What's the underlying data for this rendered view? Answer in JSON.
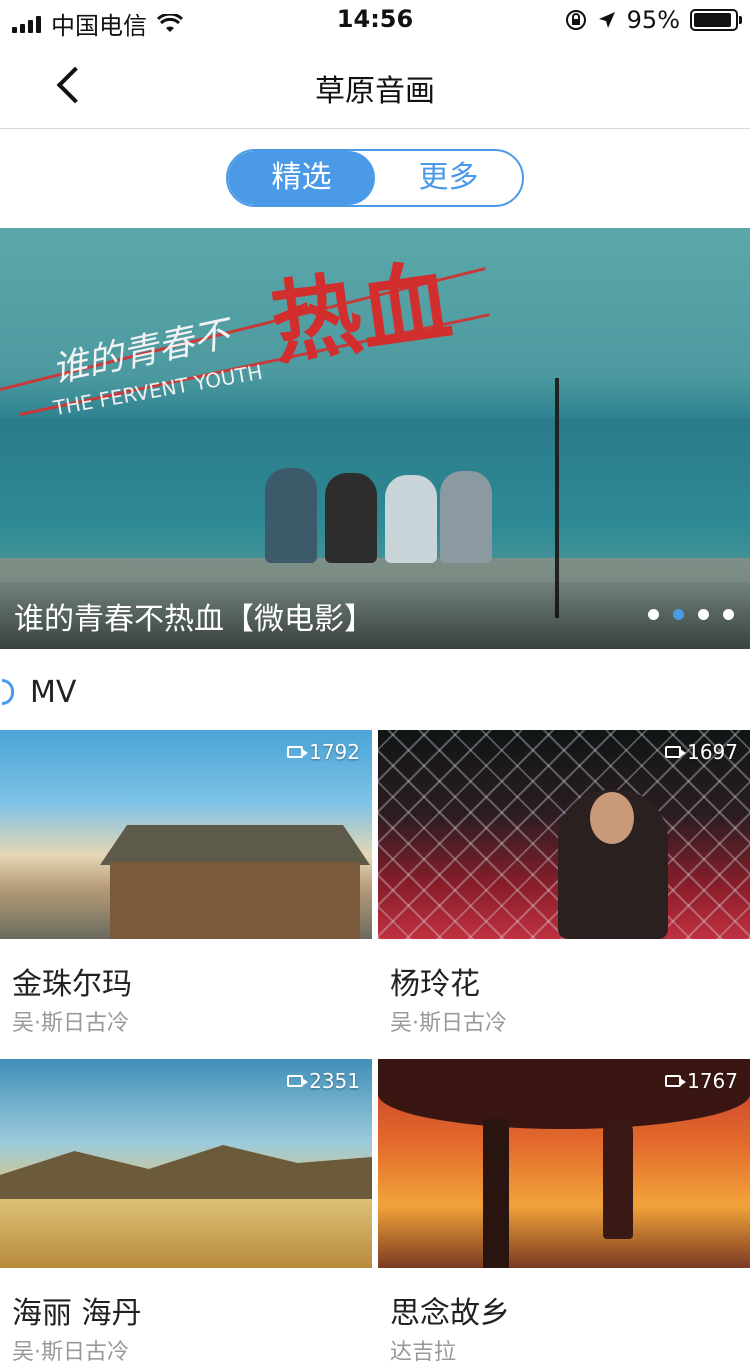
{
  "status_bar": {
    "carrier": "中国电信",
    "time": "14:56",
    "battery": "95%",
    "battery_level": 0.95
  },
  "nav": {
    "title": "草原音画",
    "back_icon": "chevron-left-icon"
  },
  "segment": {
    "tabs": [
      {
        "label": "精选",
        "active": true
      },
      {
        "label": "更多",
        "active": false
      }
    ]
  },
  "banner": {
    "caption": "谁的青春不热血【微电影】",
    "art_text": "谁的青春不",
    "art_hot": "热血",
    "art_en": "THE FERVENT YOUTH",
    "dots_total": 4,
    "dots_active_index": 1
  },
  "section": {
    "label": "MV"
  },
  "videos": [
    {
      "title": "金珠尔玛",
      "artist": "吴·斯日古冷",
      "views": "1792"
    },
    {
      "title": "杨玲花",
      "artist": "吴·斯日古冷",
      "views": "1697"
    },
    {
      "title": "海丽 海丹",
      "artist": "吴·斯日古冷",
      "views": "2351"
    },
    {
      "title": "思念故乡",
      "artist": "达吉拉",
      "views": "1767"
    }
  ],
  "colors": {
    "accent": "#4a9ae8"
  }
}
